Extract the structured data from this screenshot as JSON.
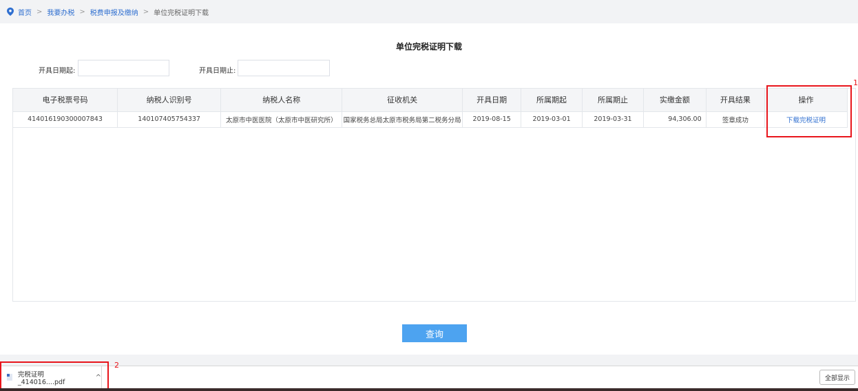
{
  "breadcrumb": {
    "home": "首页",
    "sep": ">",
    "level1": "我要办税",
    "level2": "税费申报及缴纳",
    "current": "单位完税证明下载"
  },
  "page_title": "单位完税证明下载",
  "filters": {
    "start_label": "开具日期起:",
    "start_value": "",
    "end_label": "开具日期止:",
    "end_value": ""
  },
  "table": {
    "headers": [
      "电子税票号码",
      "纳税人识别号",
      "纳税人名称",
      "征收机关",
      "开具日期",
      "所属期起",
      "所属期止",
      "实缴金额",
      "开具结果",
      "操作"
    ],
    "rows": [
      {
        "ticket_no": "414016190300007843",
        "taxpayer_id": "140107405754337",
        "taxpayer_name": "太原市中医医院（太原市中医研究所）",
        "tax_office": "国家税务总局太原市税务局第二税务分局",
        "issue_date": "2019-08-15",
        "period_start": "2019-03-01",
        "period_end": "2019-03-31",
        "amount": "94,306.00",
        "result": "签章成功",
        "action": "下载完税证明"
      }
    ]
  },
  "query_button": "查询",
  "annotations": {
    "one": "1",
    "two": "2"
  },
  "download_bar": {
    "file_name": "完税证明_414016....pdf",
    "chevron": "^",
    "show_all": "全部显示"
  },
  "colors": {
    "link": "#2f6fd0",
    "button": "#4da3f0",
    "annotation": "#e8141b"
  }
}
